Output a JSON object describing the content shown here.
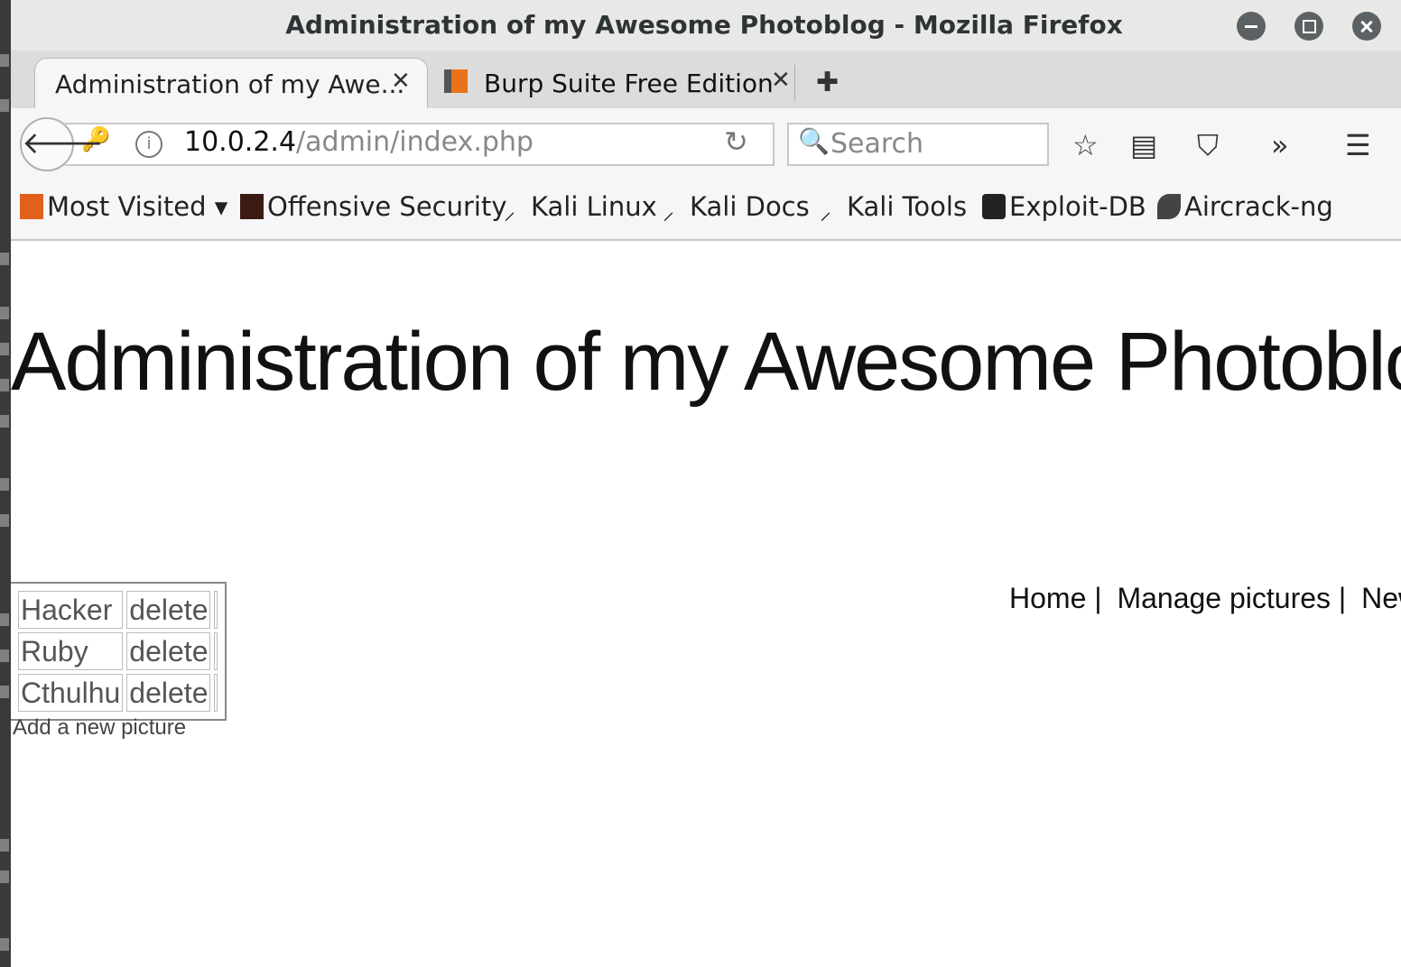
{
  "window": {
    "title": "Administration of my Awesome Photoblog - Mozilla Firefox"
  },
  "tabs": [
    {
      "label": "Administration of my Awe...",
      "active": true
    },
    {
      "label": "Burp Suite Free Edition",
      "active": false
    }
  ],
  "urlbar": {
    "host": "10.0.2.4",
    "path": "/admin/index.php"
  },
  "search": {
    "placeholder": "Search"
  },
  "bookmarks": [
    {
      "label": "Most Visited ▾",
      "icon": "folder-rss-icon"
    },
    {
      "label": "Offensive Security",
      "icon": "offsec-icon"
    },
    {
      "label": "Kali Linux",
      "icon": "kali-icon"
    },
    {
      "label": "Kali Docs",
      "icon": "kali-icon"
    },
    {
      "label": "Kali Tools",
      "icon": "kali-icon"
    },
    {
      "label": "Exploit-DB",
      "icon": "exploitdb-icon"
    },
    {
      "label": "Aircrack-ng",
      "icon": "aircrack-icon"
    }
  ],
  "page": {
    "heading": "Administration of my Awesome Photoblog",
    "nav": [
      "Home |",
      "Manage pictures |",
      "New"
    ],
    "pictures": [
      {
        "name": "Hacker",
        "action": "delete"
      },
      {
        "name": "Ruby",
        "action": "delete"
      },
      {
        "name": "Cthulhu",
        "action": "delete"
      }
    ],
    "add_link": "Add a new picture"
  },
  "colors": {
    "titlebar": "#e8e8e7",
    "toolbar": "#f5f6f7",
    "page_bg": "#ffffff"
  }
}
